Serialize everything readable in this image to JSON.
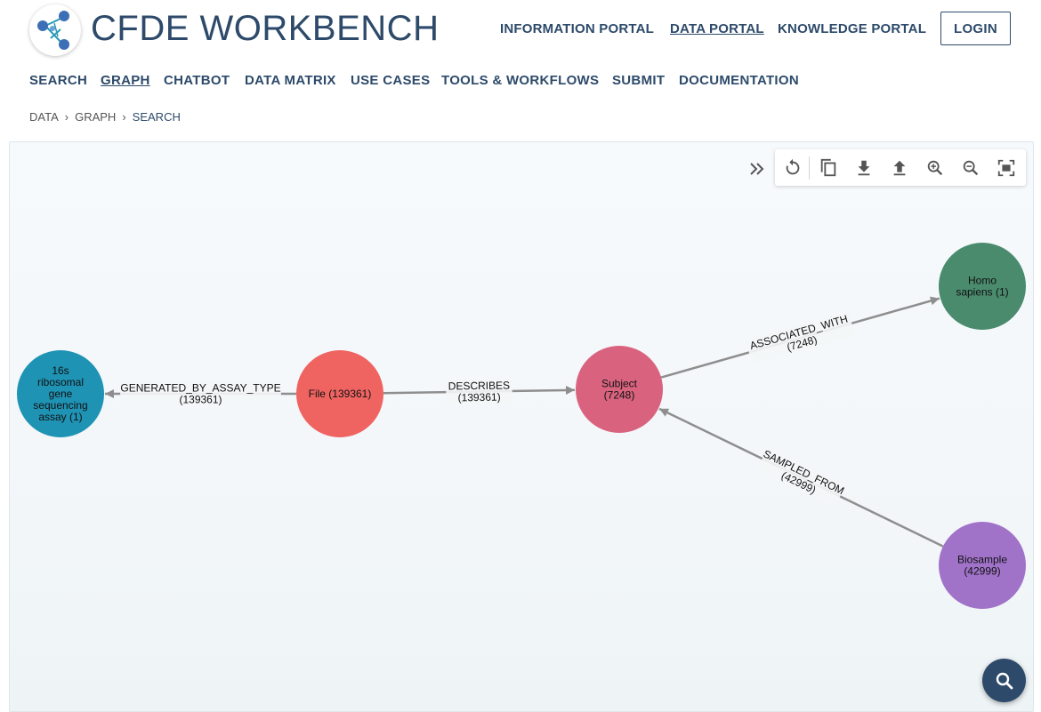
{
  "brand": {
    "title": "CFDE WORKBENCH",
    "logo_icon": "cfde-molecule-logo"
  },
  "portals": [
    {
      "label": "INFORMATION PORTAL",
      "active": false
    },
    {
      "label": "DATA PORTAL",
      "active": true
    },
    {
      "label": "KNOWLEDGE PORTAL",
      "active": false
    }
  ],
  "login_label": "LOGIN",
  "nav": [
    {
      "label": "SEARCH",
      "active": false
    },
    {
      "label": "GRAPH",
      "active": true
    },
    {
      "label": "CHATBOT",
      "active": false
    },
    {
      "label": "DATA MATRIX",
      "active": false
    },
    {
      "label": "USE CASES",
      "active": false
    },
    {
      "label": "TOOLS & WORKFLOWS",
      "active": false
    },
    {
      "label": "SUBMIT",
      "active": false
    },
    {
      "label": "DOCUMENTATION",
      "active": false
    }
  ],
  "breadcrumb": [
    {
      "label": "DATA"
    },
    {
      "label": "GRAPH"
    },
    {
      "label": "SEARCH"
    }
  ],
  "breadcrumb_separator": "›",
  "toolbar": {
    "expand_icon": "double-chevron-right-icon",
    "buttons": [
      {
        "name": "reset-layout-button",
        "icon": "rotate-icon"
      },
      {
        "name": "copy-button",
        "icon": "copy-icon"
      },
      {
        "name": "download-button",
        "icon": "download-icon"
      },
      {
        "name": "upload-button",
        "icon": "upload-icon"
      },
      {
        "name": "zoom-in-button",
        "icon": "zoom-in-icon"
      },
      {
        "name": "zoom-out-button",
        "icon": "zoom-out-icon"
      },
      {
        "name": "fit-view-button",
        "icon": "fit-screen-icon"
      }
    ]
  },
  "graph": {
    "nodes": [
      {
        "id": "assay",
        "lines": [
          "16s",
          "ribosomal",
          "gene",
          "sequencing",
          "assay (1)"
        ],
        "color": "#1f93b4"
      },
      {
        "id": "file",
        "lines": [
          "File (139361)"
        ],
        "color": "#ef6461"
      },
      {
        "id": "subject",
        "lines": [
          "Subject",
          "(7248)"
        ],
        "color": "#d9637f"
      },
      {
        "id": "homo",
        "lines": [
          "Homo",
          "sapiens (1)"
        ],
        "color": "#4a8b6e"
      },
      {
        "id": "biosample",
        "lines": [
          "Biosample",
          "(42999)"
        ],
        "color": "#a073c9"
      }
    ],
    "edges": [
      {
        "from": "file",
        "to": "assay",
        "lines": [
          "GENERATED_BY_ASSAY_TYPE",
          "(139361)"
        ]
      },
      {
        "from": "file",
        "to": "subject",
        "lines": [
          "DESCRIBES",
          "(139361)"
        ]
      },
      {
        "from": "subject",
        "to": "homo",
        "lines": [
          "ASSOCIATED_WITH",
          "(7248)"
        ]
      },
      {
        "from": "biosample",
        "to": "subject",
        "lines": [
          "SAMPLED_FROM",
          "(42999)"
        ]
      }
    ],
    "edge_color": "#8e8e8e"
  },
  "search_fab_icon": "search-icon",
  "colors": {
    "brand": "#2d4a6a",
    "canvas_bg": "#f4f8fb"
  }
}
